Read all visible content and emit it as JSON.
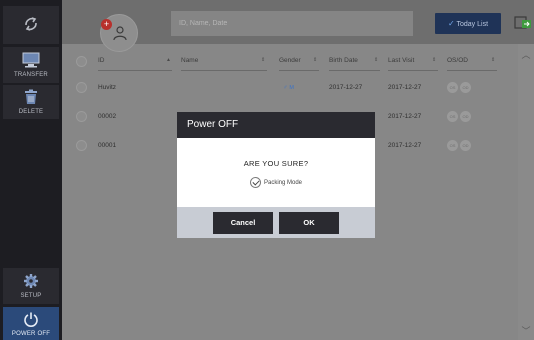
{
  "sidebar": {
    "transfer_label": "TRANSFER",
    "delete_label": "DELETE",
    "setup_label": "SETUP",
    "power_label": "POWER OFF"
  },
  "topbar": {
    "search_placeholder": "ID, Name, Date",
    "today_list_label": "Today List"
  },
  "table": {
    "headers": [
      "ID",
      "Name",
      "Gender",
      "Birth Date",
      "Last Visit",
      "OS/OD"
    ],
    "rows": [
      {
        "id": "Huvitz",
        "gender": "M",
        "birth": "2017-12-27",
        "last": "2017-12-27",
        "os": "OS",
        "od": "OD"
      },
      {
        "id": "00002",
        "last": "2017-12-27",
        "os": "OS",
        "od": "OD"
      },
      {
        "id": "00001",
        "last": "2017-12-27",
        "os": "OS",
        "od": "OD"
      }
    ]
  },
  "dialog": {
    "title": "Power OFF",
    "question": "ARE YOU SURE?",
    "option_label": "Packing Mode",
    "cancel_label": "Cancel",
    "ok_label": "OK"
  },
  "colors": {
    "dialog_dark": "#2a2a30",
    "power_button": "#2b4a7a",
    "today_button": "#1f3357",
    "new_patient_plus": "#b8302c"
  }
}
